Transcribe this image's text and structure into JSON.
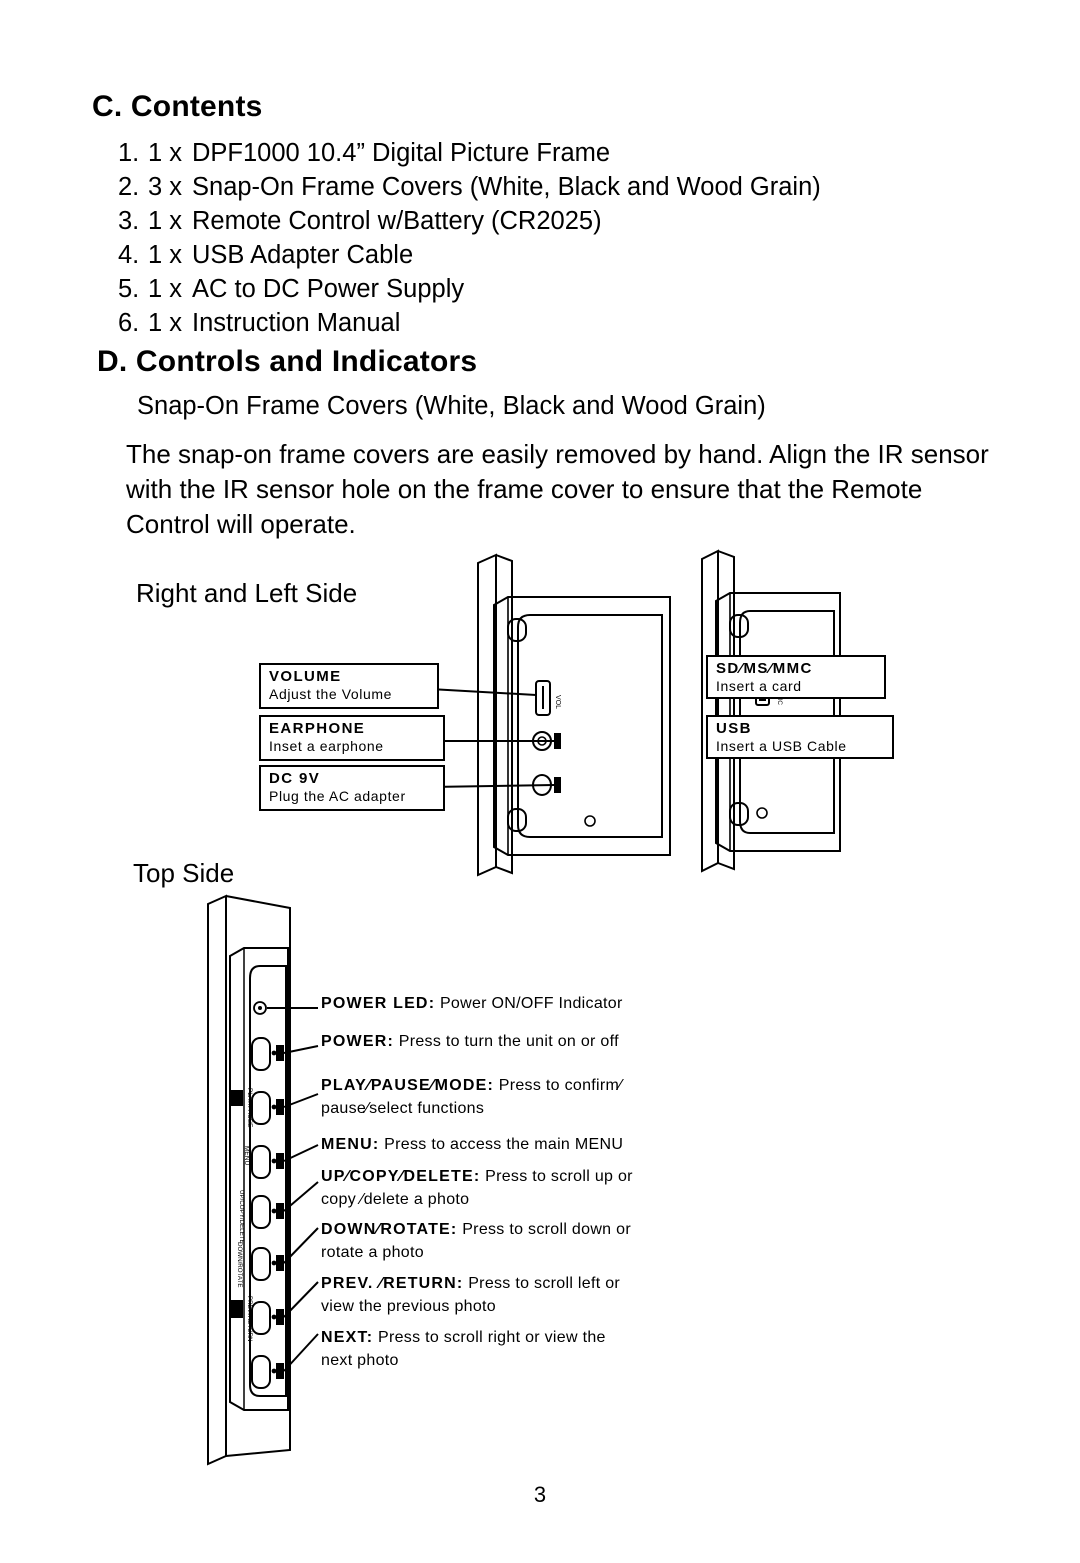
{
  "document": {
    "page_number": "3",
    "headings": {
      "contents": "C. Contents",
      "controls": "D. Controls and Indicators"
    },
    "contents_items": [
      {
        "num": "1.",
        "qty": "1 x",
        "text": "DPF1000 10.4” Digital Picture Frame"
      },
      {
        "num": "2.",
        "qty": "3 x",
        "text": "Snap-On Frame Covers (White, Black and Wood Grain)"
      },
      {
        "num": "3.",
        "qty": "1 x",
        "text": "Remote Control w/Battery (CR2025)"
      },
      {
        "num": "4.",
        "qty": "1 x",
        "text": "USB Adapter Cable"
      },
      {
        "num": "5.",
        "qty": "1 x",
        "text": "AC to DC Power Supply"
      },
      {
        "num": "6.",
        "qty": "1 x",
        "text": "Instruction Manual"
      }
    ],
    "subheads": {
      "snap_on": "Snap-On Frame Covers (White, Black and Wood Grain)",
      "right_left_side": "Right and Left Side",
      "top_side": "Top Side"
    },
    "paragraph": "The snap-on frame covers are easily removed by hand. Align the IR sensor with the IR sensor hole on the frame cover to ensure that the Remote Control will operate."
  },
  "figure_side": {
    "callouts_left": [
      {
        "title": "VOLUME",
        "sub": "Adjust the Volume"
      },
      {
        "title": "EARPHONE",
        "sub": "Inset a earphone"
      },
      {
        "title": "DC 9V",
        "sub": "Plug the AC adapter"
      }
    ],
    "callouts_right": [
      {
        "title": "SD⁄MS⁄MMC",
        "sub": "Insert a card"
      },
      {
        "title": "USB",
        "sub": "Insert a USB Cable"
      }
    ],
    "device_port_labels": [
      "VOL",
      "SD/MS/MMC",
      "USB"
    ]
  },
  "figure_top": {
    "labels": [
      {
        "bold": "POWER LED:",
        "rest": " Power ON/OFF Indicator",
        "line2": ""
      },
      {
        "bold": "POWER:",
        "rest": " Press  to  turn  the  unit  on  or  off",
        "line2": ""
      },
      {
        "bold": "PLAY⁄PAUSE⁄MODE:",
        "rest": " Press  to  confirm⁄",
        "line2": "pause⁄select  functions"
      },
      {
        "bold": "MENU:",
        "rest": " Press  to  access  the  main  MENU",
        "line2": ""
      },
      {
        "bold": "UP⁄COPY⁄DELETE:",
        "rest": " Press  to scroll up or",
        "line2": "copy ⁄delete a photo"
      },
      {
        "bold": "DOWN⁄ROTATE:",
        "rest": " Press  to scroll down or",
        "line2": "rotate a photo"
      },
      {
        "bold": "PREV. ⁄RETURN:",
        "rest": " Press  to  scroll left  or",
        "line2": "view  the  previous  photo"
      },
      {
        "bold": "NEXT:",
        "rest": " Press  to  scroll right or  view  the",
        "line2": "next  photo"
      }
    ],
    "button_side_labels": [
      "PLAY/PAUSE",
      "MENU",
      "UP/COPY/DELETE",
      "DOWN/ROTATE",
      "PREV./RETURN",
      "NEXT"
    ]
  }
}
